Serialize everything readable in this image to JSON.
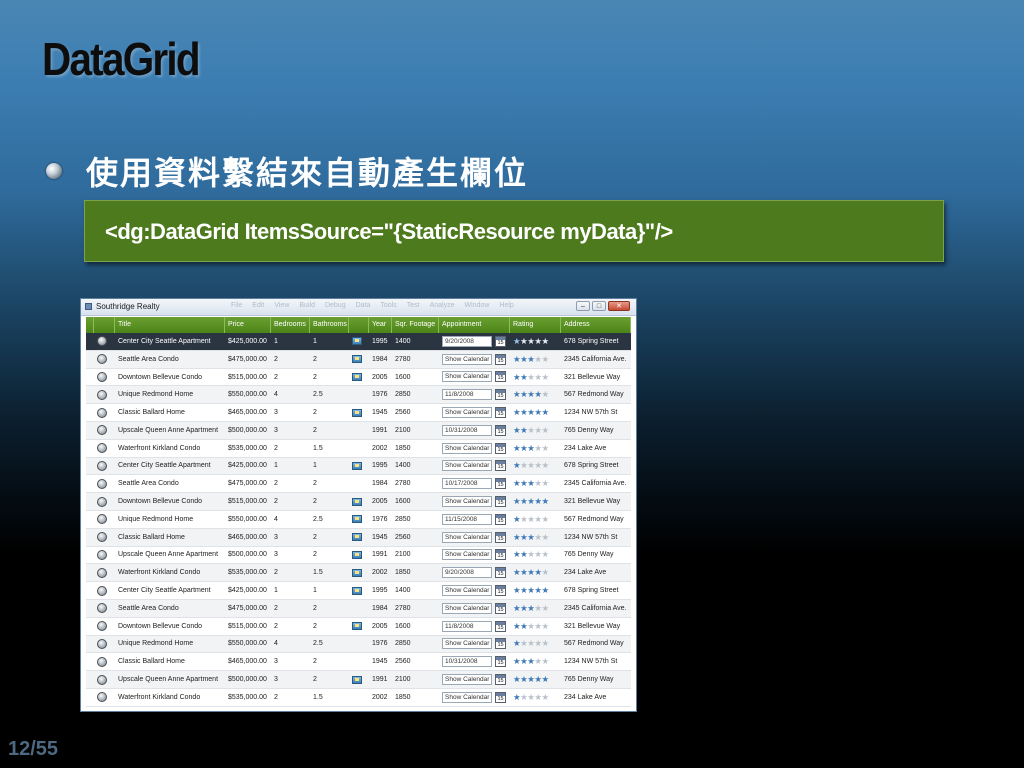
{
  "slide": {
    "title": "DataGrid",
    "bullet": "使用資料繫結來自動產生欄位",
    "code": "<dg:DataGrid ItemsSource=\"{StaticResource myData}\"/>",
    "page_number": "12/55"
  },
  "window": {
    "title": "Southridge Realty",
    "ghost_menu": [
      "File",
      "Edit",
      "View",
      "Build",
      "Debug",
      "Data",
      "Tools",
      "Test",
      "Analyze",
      "Window",
      "Help"
    ],
    "controls": [
      "–",
      "□",
      "✕"
    ]
  },
  "grid": {
    "columns": [
      "",
      "Title",
      "Price",
      "Bedrooms",
      "Bathrooms",
      "",
      "Year",
      "Sqr. Footage",
      "Appointment",
      "Rating",
      "Address"
    ],
    "rows": [
      {
        "title": "Center City Seattle Apartment",
        "price": "$425,000.00",
        "bed": "1",
        "bath": "1",
        "flag": true,
        "year": "1995",
        "sq": "1400",
        "appt": "9/20/2008",
        "rating": 1,
        "address": "678 Spring Street"
      },
      {
        "title": "Seattle Area Condo",
        "price": "$475,000.00",
        "bed": "2",
        "bath": "2",
        "flag": true,
        "year": "1984",
        "sq": "2780",
        "appt": "Show Calendar",
        "rating": 3,
        "address": "2345 California Ave."
      },
      {
        "title": "Downtown Bellevue Condo",
        "price": "$515,000.00",
        "bed": "2",
        "bath": "2",
        "flag": true,
        "year": "2005",
        "sq": "1600",
        "appt": "Show Calendar",
        "rating": 2,
        "address": "321 Bellevue Way"
      },
      {
        "title": "Unique Redmond Home",
        "price": "$550,000.00",
        "bed": "4",
        "bath": "2.5",
        "flag": false,
        "year": "1976",
        "sq": "2850",
        "appt": "11/8/2008",
        "rating": 4,
        "address": "567 Redmond Way"
      },
      {
        "title": "Classic Ballard Home",
        "price": "$465,000.00",
        "bed": "3",
        "bath": "2",
        "flag": true,
        "year": "1945",
        "sq": "2560",
        "appt": "Show Calendar",
        "rating": 5,
        "address": "1234 NW 57th St"
      },
      {
        "title": "Upscale Queen Anne Apartment",
        "price": "$500,000.00",
        "bed": "3",
        "bath": "2",
        "flag": false,
        "year": "1991",
        "sq": "2100",
        "appt": "10/31/2008",
        "rating": 2,
        "address": "765 Denny Way"
      },
      {
        "title": "Waterfront Kirkland Condo",
        "price": "$535,000.00",
        "bed": "2",
        "bath": "1.5",
        "flag": false,
        "year": "2002",
        "sq": "1850",
        "appt": "Show Calendar",
        "rating": 3,
        "address": "234 Lake Ave"
      },
      {
        "title": "Center City Seattle Apartment",
        "price": "$425,000.00",
        "bed": "1",
        "bath": "1",
        "flag": true,
        "year": "1995",
        "sq": "1400",
        "appt": "Show Calendar",
        "rating": 1,
        "address": "678 Spring Street"
      },
      {
        "title": "Seattle Area Condo",
        "price": "$475,000.00",
        "bed": "2",
        "bath": "2",
        "flag": false,
        "year": "1984",
        "sq": "2780",
        "appt": "10/17/2008",
        "rating": 3,
        "address": "2345 California Ave."
      },
      {
        "title": "Downtown Bellevue Condo",
        "price": "$515,000.00",
        "bed": "2",
        "bath": "2",
        "flag": true,
        "year": "2005",
        "sq": "1600",
        "appt": "Show Calendar",
        "rating": 5,
        "address": "321 Bellevue Way"
      },
      {
        "title": "Unique Redmond Home",
        "price": "$550,000.00",
        "bed": "4",
        "bath": "2.5",
        "flag": true,
        "year": "1976",
        "sq": "2850",
        "appt": "11/15/2008",
        "rating": 1,
        "address": "567 Redmond Way"
      },
      {
        "title": "Classic Ballard Home",
        "price": "$465,000.00",
        "bed": "3",
        "bath": "2",
        "flag": true,
        "year": "1945",
        "sq": "2560",
        "appt": "Show Calendar",
        "rating": 3,
        "address": "1234 NW 57th St"
      },
      {
        "title": "Upscale Queen Anne Apartment",
        "price": "$500,000.00",
        "bed": "3",
        "bath": "2",
        "flag": true,
        "year": "1991",
        "sq": "2100",
        "appt": "Show Calendar",
        "rating": 2,
        "address": "765 Denny Way"
      },
      {
        "title": "Waterfront Kirkland Condo",
        "price": "$535,000.00",
        "bed": "2",
        "bath": "1.5",
        "flag": true,
        "year": "2002",
        "sq": "1850",
        "appt": "9/20/2008",
        "rating": 4,
        "address": "234 Lake Ave"
      },
      {
        "title": "Center City Seattle Apartment",
        "price": "$425,000.00",
        "bed": "1",
        "bath": "1",
        "flag": true,
        "year": "1995",
        "sq": "1400",
        "appt": "Show Calendar",
        "rating": 5,
        "address": "678 Spring Street"
      },
      {
        "title": "Seattle Area Condo",
        "price": "$475,000.00",
        "bed": "2",
        "bath": "2",
        "flag": false,
        "year": "1984",
        "sq": "2780",
        "appt": "Show Calendar",
        "rating": 3,
        "address": "2345 California Ave."
      },
      {
        "title": "Downtown Bellevue Condo",
        "price": "$515,000.00",
        "bed": "2",
        "bath": "2",
        "flag": true,
        "year": "2005",
        "sq": "1600",
        "appt": "11/8/2008",
        "rating": 2,
        "address": "321 Bellevue Way"
      },
      {
        "title": "Unique Redmond Home",
        "price": "$550,000.00",
        "bed": "4",
        "bath": "2.5",
        "flag": false,
        "year": "1976",
        "sq": "2850",
        "appt": "Show Calendar",
        "rating": 1,
        "address": "567 Redmond Way"
      },
      {
        "title": "Classic Ballard Home",
        "price": "$465,000.00",
        "bed": "3",
        "bath": "2",
        "flag": false,
        "year": "1945",
        "sq": "2560",
        "appt": "10/31/2008",
        "rating": 3,
        "address": "1234 NW 57th St"
      },
      {
        "title": "Upscale Queen Anne Apartment",
        "price": "$500,000.00",
        "bed": "3",
        "bath": "2",
        "flag": true,
        "year": "1991",
        "sq": "2100",
        "appt": "Show Calendar",
        "rating": 5,
        "address": "765 Denny Way"
      },
      {
        "title": "Waterfront Kirkland Condo",
        "price": "$535,000.00",
        "bed": "2",
        "bath": "1.5",
        "flag": false,
        "year": "2002",
        "sq": "1850",
        "appt": "Show Calendar",
        "rating": 1,
        "address": "234 Lake Ave"
      }
    ],
    "calendar_day": "15",
    "selected_row": 0,
    "header_color": "#5a921f",
    "star_color": "#3f78b7"
  }
}
